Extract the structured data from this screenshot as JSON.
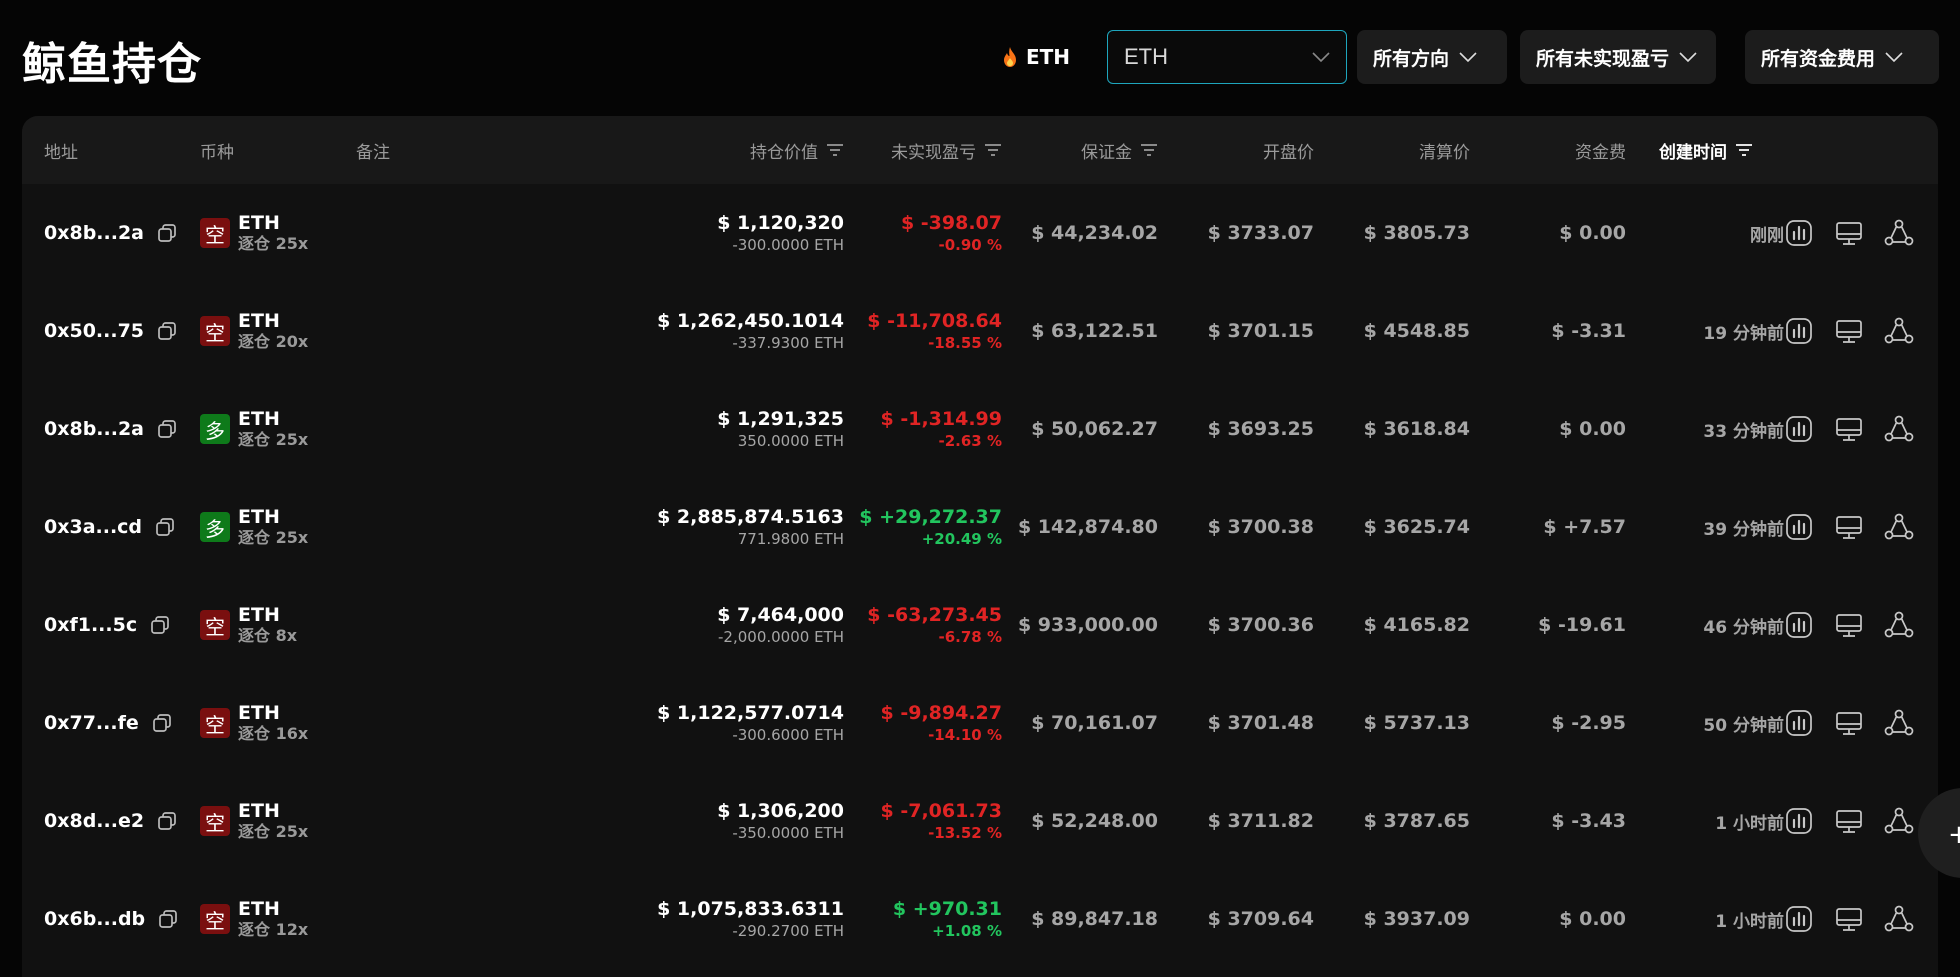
{
  "header": {
    "title": "鲸鱼持仓",
    "coin_chip": "ETH",
    "coin_select_value": "ETH",
    "filters": [
      "所有方向",
      "所有未实现盈亏",
      "所有资金费用"
    ]
  },
  "table": {
    "columns": {
      "address": "地址",
      "coin": "币种",
      "note": "备注",
      "position_value": "持仓价值",
      "unrealized_pnl": "未实现盈亏",
      "margin": "保证金",
      "open_price": "开盘价",
      "liq_price": "清算价",
      "funding": "资金费",
      "created": "创建时间"
    },
    "rows": [
      {
        "address": "0x8b...2a",
        "side": "空",
        "side_type": "short",
        "coin": "ETH",
        "leverage": "逐仓 25x",
        "value": "$ 1,120,320",
        "size": "-300.0000 ETH",
        "pnl": "$ -398.07",
        "pnl_pct": "-0.90 %",
        "pnl_color": "red",
        "margin": "$ 44,234.02",
        "open": "$ 3733.07",
        "liq": "$ 3805.73",
        "funding": "$ 0.00",
        "funding_color": "grey",
        "created": "刚刚"
      },
      {
        "address": "0x50...75",
        "side": "空",
        "side_type": "short",
        "coin": "ETH",
        "leverage": "逐仓 20x",
        "value": "$ 1,262,450.1014",
        "size": "-337.9300 ETH",
        "pnl": "$ -11,708.64",
        "pnl_pct": "-18.55 %",
        "pnl_color": "red",
        "margin": "$ 63,122.51",
        "open": "$ 3701.15",
        "liq": "$ 4548.85",
        "funding": "$ -3.31",
        "funding_color": "red",
        "created": "19 分钟前"
      },
      {
        "address": "0x8b...2a",
        "side": "多",
        "side_type": "long",
        "coin": "ETH",
        "leverage": "逐仓 25x",
        "value": "$ 1,291,325",
        "size": "350.0000 ETH",
        "pnl": "$ -1,314.99",
        "pnl_pct": "-2.63 %",
        "pnl_color": "red",
        "margin": "$ 50,062.27",
        "open": "$ 3693.25",
        "liq": "$ 3618.84",
        "funding": "$ 0.00",
        "funding_color": "grey",
        "created": "33 分钟前"
      },
      {
        "address": "0x3a...cd",
        "side": "多",
        "side_type": "long",
        "coin": "ETH",
        "leverage": "逐仓 25x",
        "value": "$ 2,885,874.5163",
        "size": "771.9800 ETH",
        "pnl": "$ +29,272.37",
        "pnl_pct": "+20.49 %",
        "pnl_color": "green",
        "margin": "$ 142,874.80",
        "open": "$ 3700.38",
        "liq": "$ 3625.74",
        "funding": "$ +7.57",
        "funding_color": "green",
        "created": "39 分钟前"
      },
      {
        "address": "0xf1...5c",
        "side": "空",
        "side_type": "short",
        "coin": "ETH",
        "leverage": "逐仓 8x",
        "value": "$ 7,464,000",
        "size": "-2,000.0000 ETH",
        "pnl": "$ -63,273.45",
        "pnl_pct": "-6.78 %",
        "pnl_color": "red",
        "margin": "$ 933,000.00",
        "open": "$ 3700.36",
        "liq": "$ 4165.82",
        "funding": "$ -19.61",
        "funding_color": "red",
        "created": "46 分钟前"
      },
      {
        "address": "0x77...fe",
        "side": "空",
        "side_type": "short",
        "coin": "ETH",
        "leverage": "逐仓 16x",
        "value": "$ 1,122,577.0714",
        "size": "-300.6000 ETH",
        "pnl": "$ -9,894.27",
        "pnl_pct": "-14.10 %",
        "pnl_color": "red",
        "margin": "$ 70,161.07",
        "open": "$ 3701.48",
        "liq": "$ 5737.13",
        "funding": "$ -2.95",
        "funding_color": "red",
        "created": "50 分钟前"
      },
      {
        "address": "0x8d...e2",
        "side": "空",
        "side_type": "short",
        "coin": "ETH",
        "leverage": "逐仓 25x",
        "value": "$ 1,306,200",
        "size": "-350.0000 ETH",
        "pnl": "$ -7,061.73",
        "pnl_pct": "-13.52 %",
        "pnl_color": "red",
        "margin": "$ 52,248.00",
        "open": "$ 3711.82",
        "liq": "$ 3787.65",
        "funding": "$ -3.43",
        "funding_color": "red",
        "created": "1 小时前"
      },
      {
        "address": "0x6b...db",
        "side": "空",
        "side_type": "short",
        "coin": "ETH",
        "leverage": "逐仓 12x",
        "value": "$ 1,075,833.6311",
        "size": "-290.2700 ETH",
        "pnl": "$ +970.31",
        "pnl_pct": "+1.08 %",
        "pnl_color": "green",
        "margin": "$ 89,847.18",
        "open": "$ 3709.64",
        "liq": "$ 3937.09",
        "funding": "$ 0.00",
        "funding_color": "grey",
        "created": "1 小时前"
      }
    ]
  },
  "icons": {
    "fire": "fire-icon",
    "caret": "chevron-down-icon",
    "sort": "sort-icon",
    "copy": "copy-icon",
    "chart": "bar-chart-icon",
    "monitor": "monitor-icon",
    "share": "share-icon"
  },
  "colors": {
    "accent": "#1ea6bd",
    "red": "#e02424",
    "green": "#22c55e",
    "short_badge": "#7a0f0f",
    "long_badge": "#0e7a1a"
  }
}
